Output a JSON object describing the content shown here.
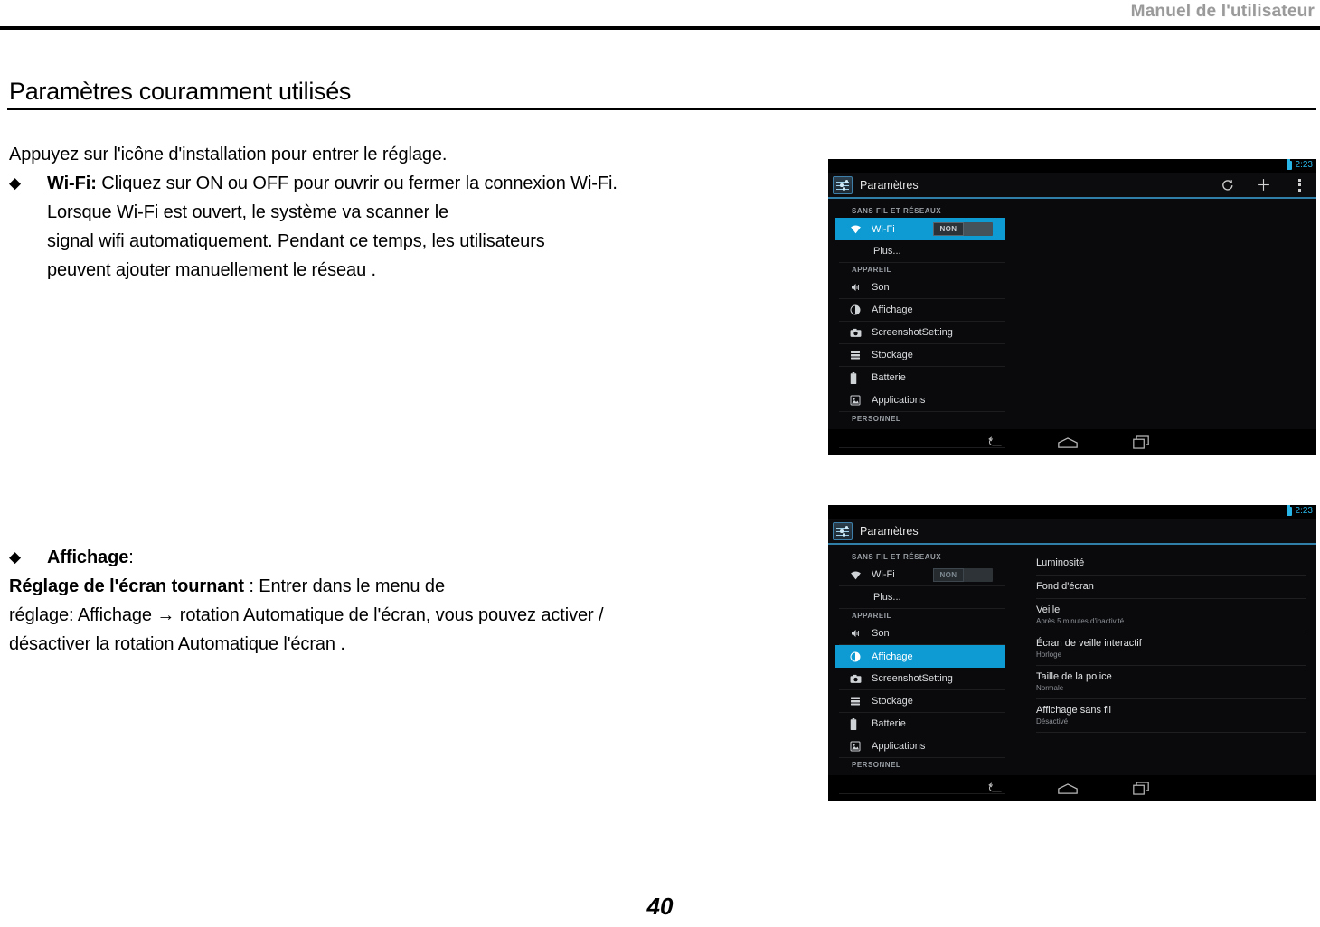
{
  "page": {
    "header_title": "Manuel de l'utilisateur",
    "section_heading": "Paramètres couramment utilisés",
    "page_number": "40"
  },
  "body": {
    "intro": "Appuyez sur l'icône d'installation pour entrer le réglage.",
    "bullet_mark": "◆",
    "wifi_bullet": {
      "term": "Wi-Fi:",
      "line1": " Cliquez sur ON ou OFF pour ouvrir ou fermer la connexion Wi-Fi.",
      "line2": "Lorsque Wi-Fi est ouvert, le système va scanner le",
      "line3": "signal wifi automatiquement. Pendant ce temps, les utilisateurs",
      "line4": "peuvent ajouter manuellement le réseau ."
    },
    "affichage_bullet": {
      "term": "Affichage",
      "term_suffix": ":",
      "line1_bold": "Réglage de l'écran tournant",
      "line1_rest": " : Entrer dans le menu de",
      "line2": "réglage: Affichage → rotation Automatique de l'écran, vous pouvez activer /",
      "line3": "désactiver la rotation Automatique l'écran ."
    }
  },
  "screenshot_1": {
    "status": {
      "time": "2:23",
      "battery_icon": "battery-icon"
    },
    "action_bar": {
      "app_icon": "settings-sliders-icon",
      "title": "Paramètres",
      "refresh_icon": "refresh-icon",
      "add_icon": "plus-icon",
      "overflow_icon": "overflow-menu-icon"
    },
    "groups": [
      {
        "label": "SANS FIL ET RÉSEAUX",
        "items": [
          {
            "label": "Wi-Fi",
            "icon": "wifi-icon",
            "selected": true,
            "toggle": "NON"
          },
          {
            "label": "Plus...",
            "icon": null,
            "selected": false
          }
        ]
      },
      {
        "label": "APPAREIL",
        "items": [
          {
            "label": "Son",
            "icon": "sound-icon",
            "selected": false
          },
          {
            "label": "Affichage",
            "icon": "display-icon",
            "selected": false
          },
          {
            "label": "ScreenshotSetting",
            "icon": "camera-icon",
            "selected": false
          },
          {
            "label": "Stockage",
            "icon": "storage-icon",
            "selected": false
          },
          {
            "label": "Batterie",
            "icon": "battery-icon",
            "selected": false
          },
          {
            "label": "Applications",
            "icon": "applications-icon",
            "selected": false
          }
        ]
      },
      {
        "label": "PERSONNEL",
        "items": []
      }
    ],
    "nav": {
      "back": "back-icon",
      "home": "home-icon",
      "recents": "recent-apps-icon"
    }
  },
  "screenshot_2": {
    "status": {
      "time": "2:23",
      "battery_icon": "battery-icon"
    },
    "action_bar": {
      "app_icon": "settings-sliders-icon",
      "title": "Paramètres"
    },
    "groups": [
      {
        "label": "SANS FIL ET RÉSEAUX",
        "items": [
          {
            "label": "Wi-Fi",
            "icon": "wifi-icon",
            "selected": false,
            "toggle": "NON"
          },
          {
            "label": "Plus...",
            "icon": null,
            "selected": false
          }
        ]
      },
      {
        "label": "APPAREIL",
        "items": [
          {
            "label": "Son",
            "icon": "sound-icon",
            "selected": false
          },
          {
            "label": "Affichage",
            "icon": "display-icon",
            "selected": true
          },
          {
            "label": "ScreenshotSetting",
            "icon": "camera-icon",
            "selected": false
          },
          {
            "label": "Stockage",
            "icon": "storage-icon",
            "selected": false
          },
          {
            "label": "Batterie",
            "icon": "battery-icon",
            "selected": false
          },
          {
            "label": "Applications",
            "icon": "applications-icon",
            "selected": false
          }
        ]
      },
      {
        "label": "PERSONNEL",
        "items": []
      }
    ],
    "display_prefs": [
      {
        "title": "Luminosité",
        "sub": ""
      },
      {
        "title": "Fond d'écran",
        "sub": ""
      },
      {
        "title": "Veille",
        "sub": "Après 5 minutes d'inactivité"
      },
      {
        "title": "Écran de veille interactif",
        "sub": "Horloge"
      },
      {
        "title": "Taille de la police",
        "sub": "Normale"
      },
      {
        "title": "Affichage sans fil",
        "sub": "Désactivé"
      }
    ],
    "nav": {
      "back": "back-icon",
      "home": "home-icon",
      "recents": "recent-apps-icon"
    }
  },
  "colors": {
    "accent_blue": "#0e9bd4",
    "status_blue": "#29b6e8",
    "device_bg": "#0a0a0c",
    "action_bar_border": "#2f7fa8"
  }
}
